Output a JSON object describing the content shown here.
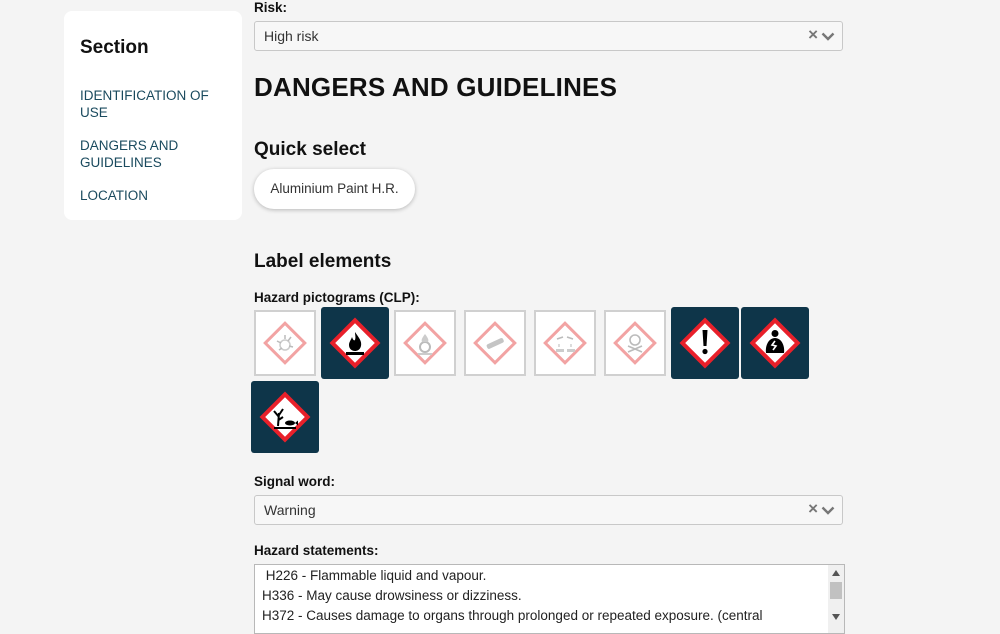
{
  "sidebar": {
    "title": "Section",
    "items": [
      {
        "label": "IDENTIFICATION OF USE"
      },
      {
        "label": "DANGERS AND GUIDELINES"
      },
      {
        "label": "LOCATION"
      }
    ]
  },
  "risk": {
    "label": "Risk:",
    "value": "High risk",
    "clear": "×"
  },
  "heading": "DANGERS AND GUIDELINES",
  "quick_select": {
    "title": "Quick select",
    "chip": "Aluminium Paint H.R."
  },
  "label_elements": {
    "title": "Label elements",
    "pictograms_label": "Hazard pictograms (CLP):"
  },
  "pictograms": [
    {
      "name": "explosive-pictogram",
      "selected": false
    },
    {
      "name": "flammable-pictogram",
      "selected": true
    },
    {
      "name": "oxidising-pictogram",
      "selected": false
    },
    {
      "name": "gas-cylinder-pictogram",
      "selected": false
    },
    {
      "name": "corrosive-pictogram",
      "selected": false
    },
    {
      "name": "toxic-skull-pictogram",
      "selected": false
    },
    {
      "name": "exclamation-pictogram",
      "selected": true
    },
    {
      "name": "health-hazard-pictogram",
      "selected": true
    },
    {
      "name": "environment-pictogram",
      "selected": true
    }
  ],
  "signal_word": {
    "label": "Signal word:",
    "value": "Warning",
    "clear": "×"
  },
  "hazard_statements": {
    "label": "Hazard statements:",
    "lines": [
      " H226 - Flammable liquid and vapour.",
      "H336 - May cause drowsiness or dizziness.",
      "H372 - Causes damage to organs through prolonged or repeated exposure. (central"
    ]
  },
  "colors": {
    "accent": "#0e3549",
    "nav": "#1a4a5e",
    "hazard_red": "#e8202a"
  }
}
